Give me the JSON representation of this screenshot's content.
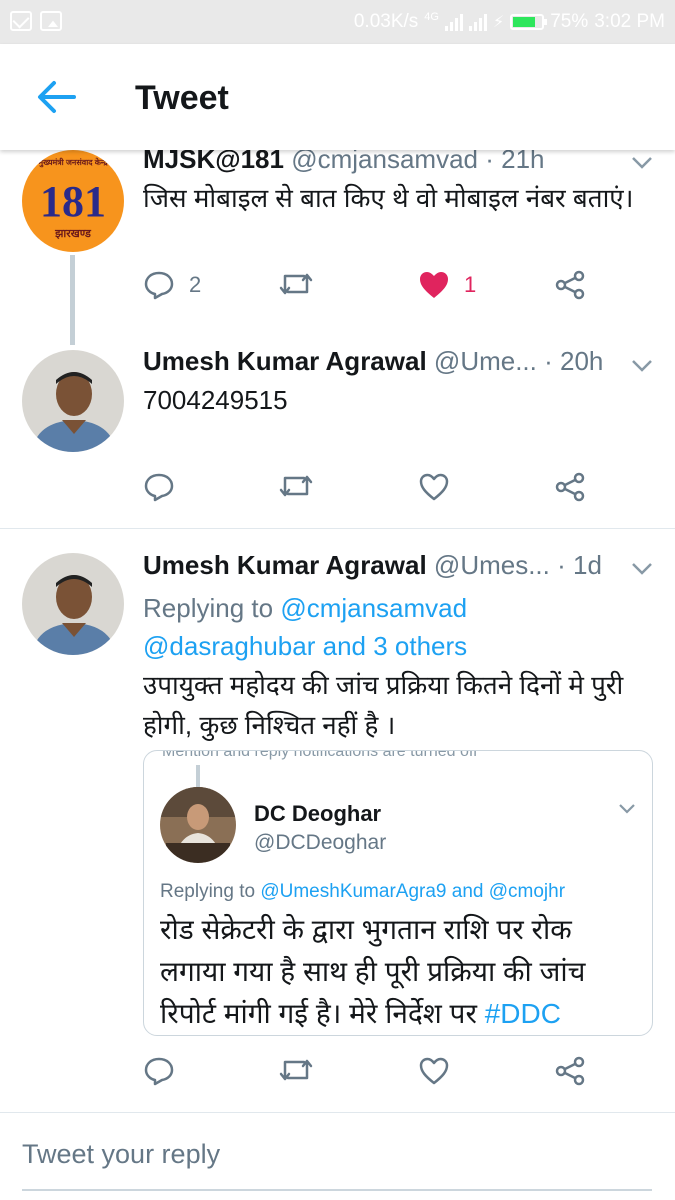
{
  "status_bar": {
    "speed": "0.03K/s",
    "network": "4G",
    "battery": "75%",
    "time": "3:02 PM"
  },
  "app_bar": {
    "title": "Tweet",
    "back_icon": "arrow-left-icon"
  },
  "tweets": [
    {
      "name": "MJSK@181",
      "handle": "@cmjansamvad",
      "time": "· 21h",
      "avatar_text": "181",
      "avatar_top_text": "मुख्यमंत्री जनसंवाद केन्द्र",
      "avatar_bottom_text": "झारखण्ड",
      "text": "जिस मोबाइल से बात किए थे वो मोबाइल नंबर बताएं।",
      "reply_count": "2",
      "like_count": "1",
      "liked": true
    },
    {
      "name": "Umesh Kumar Agrawal",
      "handle": "@Ume...",
      "time": "· 20h",
      "text": "7004249515"
    },
    {
      "name": "Umesh Kumar Agrawal",
      "handle": "@Umes...",
      "time": "· 1d",
      "replying_prefix": "Replying to",
      "replying_to_1": "@cmjansamvad",
      "replying_to_2": "@dasraghubar and 3 others",
      "text": "उपायुक्त महोदय की जांच प्रक्रिया कितने दिनों मे पुरी होगी, कुछ निश्चित नहीं है ।",
      "quote": {
        "cutoff_text": "Mention and reply notifications are turned off",
        "name": "DC Deoghar",
        "handle": "@DCDeoghar",
        "replying_prefix": "Replying to",
        "replying_to": "@UmeshKumarAgra9 and @cmojhr",
        "text_main": "रोड सेक्रेटरी के द्वारा भुगतान राशि पर रोक लगाया गया है साथ ही पूरी प्रक्रिया की जांच रिपोर्ट मांगी गई है। मेरे निर्देश पर ",
        "hashtag": "#DDC"
      }
    }
  ],
  "reply_box": {
    "placeholder": "Tweet your reply"
  },
  "colors": {
    "accent": "#1da1f2",
    "like": "#e0245e",
    "secondary_text": "#657786",
    "avatar_badge": "#f7941d"
  }
}
